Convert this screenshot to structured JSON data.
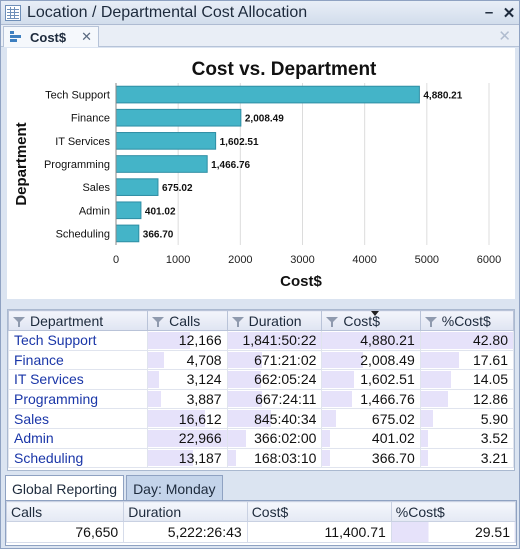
{
  "window": {
    "title": "Location / Departmental Cost Allocation"
  },
  "tabs": [
    {
      "label": "Cost$"
    }
  ],
  "chart_data": {
    "type": "bar",
    "orientation": "horizontal",
    "title": "Cost vs. Department",
    "xlabel": "Cost$",
    "ylabel": "Department",
    "categories": [
      "Tech Support",
      "Finance",
      "IT Services",
      "Programming",
      "Sales",
      "Admin",
      "Scheduling"
    ],
    "values": [
      4880.21,
      2008.49,
      1602.51,
      1466.76,
      675.02,
      401.02,
      366.7
    ],
    "value_labels": [
      "4,880.21",
      "2,008.49",
      "1,602.51",
      "1,466.76",
      "675.02",
      "401.02",
      "366.70"
    ],
    "xlim": [
      0,
      6000
    ],
    "xticks": [
      "0",
      "1000",
      "2000",
      "3000",
      "4000",
      "5000",
      "6000"
    ],
    "grid": true,
    "bar_color": "#44b4c8"
  },
  "grid": {
    "columns": [
      "Department",
      "Calls",
      "Duration",
      "Cost$",
      "%Cost$"
    ],
    "sorted_column": "Cost$",
    "rows": [
      {
        "department": "Tech Support",
        "calls": "12,166",
        "duration": "1,841:50:22",
        "cost": "4,880.21",
        "pct": "42.80",
        "calls_n": 12166,
        "duration_h": 1841.84,
        "cost_n": 4880.21,
        "pct_n": 42.8
      },
      {
        "department": "Finance",
        "calls": "4,708",
        "duration": "671:21:02",
        "cost": "2,008.49",
        "pct": "17.61",
        "calls_n": 4708,
        "duration_h": 671.35,
        "cost_n": 2008.49,
        "pct_n": 17.61
      },
      {
        "department": "IT Services",
        "calls": "3,124",
        "duration": "662:05:24",
        "cost": "1,602.51",
        "pct": "14.05",
        "calls_n": 3124,
        "duration_h": 662.09,
        "cost_n": 1602.51,
        "pct_n": 14.05
      },
      {
        "department": "Programming",
        "calls": "3,887",
        "duration": "667:24:11",
        "cost": "1,466.76",
        "pct": "12.86",
        "calls_n": 3887,
        "duration_h": 667.4,
        "cost_n": 1466.76,
        "pct_n": 12.86
      },
      {
        "department": "Sales",
        "calls": "16,612",
        "duration": "845:40:34",
        "cost": "675.02",
        "pct": "5.90",
        "calls_n": 16612,
        "duration_h": 845.68,
        "cost_n": 675.02,
        "pct_n": 5.9
      },
      {
        "department": "Admin",
        "calls": "22,966",
        "duration": "366:02:00",
        "cost": "401.02",
        "pct": "3.52",
        "calls_n": 22966,
        "duration_h": 366.03,
        "cost_n": 401.02,
        "pct_n": 3.52
      },
      {
        "department": "Scheduling",
        "calls": "13,187",
        "duration": "168:03:10",
        "cost": "366.70",
        "pct": "3.21",
        "calls_n": 13187,
        "duration_h": 168.05,
        "cost_n": 366.7,
        "pct_n": 3.21
      }
    ]
  },
  "bottom": {
    "tabs": [
      "Global Reporting",
      "Day: Monday"
    ],
    "active_tab": "Global Reporting",
    "summary_columns": [
      "Calls",
      "Duration",
      "Cost$",
      "%Cost$"
    ],
    "summary_values": [
      "76,650",
      "5,222:26:43",
      "11,400.71",
      "29.51"
    ]
  },
  "icons": {
    "window": "table-grid-icon",
    "tab": "bar-chart-icon",
    "filter": "filter-funnel-icon",
    "sort": "sort-descending-icon"
  }
}
